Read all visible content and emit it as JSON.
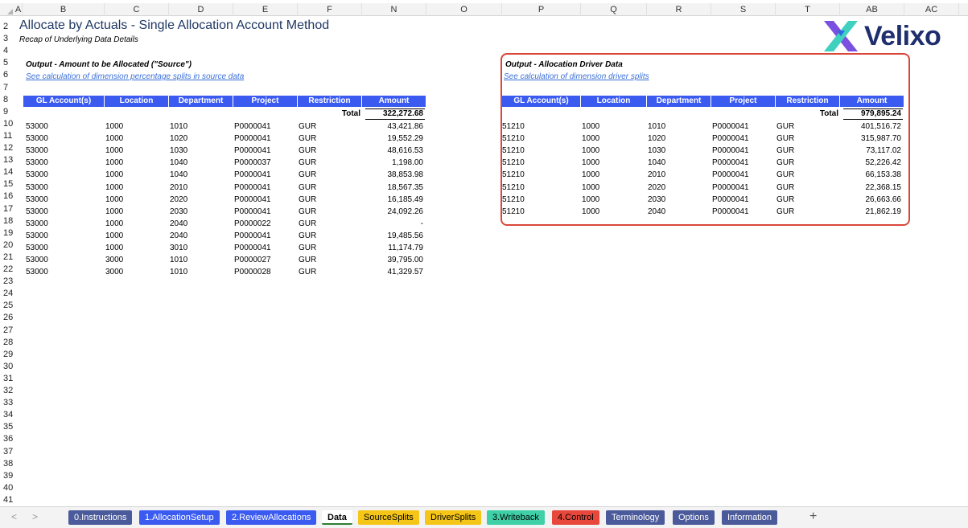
{
  "columns": [
    "A",
    "B",
    "C",
    "D",
    "E",
    "F",
    "N",
    "O",
    "P",
    "Q",
    "R",
    "S",
    "T",
    "AB",
    "AC"
  ],
  "rows": [
    "2",
    "3",
    "4",
    "5",
    "6",
    "7",
    "8",
    "9",
    "10",
    "11",
    "12",
    "13",
    "14",
    "15",
    "16",
    "17",
    "18",
    "19",
    "20",
    "21",
    "22",
    "23",
    "24",
    "25",
    "26",
    "27",
    "28",
    "29",
    "30",
    "31",
    "32",
    "33",
    "34",
    "35",
    "36",
    "37",
    "38",
    "39",
    "40",
    "41"
  ],
  "title": "Allocate by Actuals - Single Allocation Account Method",
  "subtitle": "Recap of Underlying Data Details",
  "logo_text": "Velixo",
  "source": {
    "heading": "Output - Amount to be Allocated (\"Source\")",
    "link": "See calculation of dimension percentage splits in source data",
    "headers": [
      "GL Account(s)",
      "Location",
      "Department",
      "Project",
      "Restriction",
      "Amount"
    ],
    "total_label": "Total",
    "total_value": "322,272.68",
    "rows": [
      [
        "53000",
        "1000",
        "1010",
        "P0000041",
        "GUR",
        "43,421.86"
      ],
      [
        "53000",
        "1000",
        "1020",
        "P0000041",
        "GUR",
        "19,552.29"
      ],
      [
        "53000",
        "1000",
        "1030",
        "P0000041",
        "GUR",
        "48,616.53"
      ],
      [
        "53000",
        "1000",
        "1040",
        "P0000037",
        "GUR",
        "1,198.00"
      ],
      [
        "53000",
        "1000",
        "1040",
        "P0000041",
        "GUR",
        "38,853.98"
      ],
      [
        "53000",
        "1000",
        "2010",
        "P0000041",
        "GUR",
        "18,567.35"
      ],
      [
        "53000",
        "1000",
        "2020",
        "P0000041",
        "GUR",
        "16,185.49"
      ],
      [
        "53000",
        "1000",
        "2030",
        "P0000041",
        "GUR",
        "24,092.26"
      ],
      [
        "53000",
        "1000",
        "2040",
        "P0000022",
        "GUR",
        "-"
      ],
      [
        "53000",
        "1000",
        "2040",
        "P0000041",
        "GUR",
        "19,485.56"
      ],
      [
        "53000",
        "1000",
        "3010",
        "P0000041",
        "GUR",
        "11,174.79"
      ],
      [
        "53000",
        "3000",
        "1010",
        "P0000027",
        "GUR",
        "39,795.00"
      ],
      [
        "53000",
        "3000",
        "1010",
        "P0000028",
        "GUR",
        "41,329.57"
      ]
    ]
  },
  "driver": {
    "heading": "Output - Allocation Driver Data",
    "link": "See calculation of dimension driver splits",
    "headers": [
      "GL Account(s)",
      "Location",
      "Department",
      "Project",
      "Restriction",
      "Amount"
    ],
    "total_label": "Total",
    "total_value": "979,895.24",
    "rows": [
      [
        "51210",
        "1000",
        "1010",
        "P0000041",
        "GUR",
        "401,516.72"
      ],
      [
        "51210",
        "1000",
        "1020",
        "P0000041",
        "GUR",
        "315,987.70"
      ],
      [
        "51210",
        "1000",
        "1030",
        "P0000041",
        "GUR",
        "73,117.02"
      ],
      [
        "51210",
        "1000",
        "1040",
        "P0000041",
        "GUR",
        "52,226.42"
      ],
      [
        "51210",
        "1000",
        "2010",
        "P0000041",
        "GUR",
        "66,153.38"
      ],
      [
        "51210",
        "1000",
        "2020",
        "P0000041",
        "GUR",
        "22,368.15"
      ],
      [
        "51210",
        "1000",
        "2030",
        "P0000041",
        "GUR",
        "26,663.66"
      ],
      [
        "51210",
        "1000",
        "2040",
        "P0000041",
        "GUR",
        "21,862.19"
      ]
    ]
  },
  "tabs": [
    {
      "label": "0.Instructions",
      "bg": "#4a5a9a",
      "fg": "#ffffff"
    },
    {
      "label": "1.AllocationSetup",
      "bg": "#3b5bf0",
      "fg": "#ffffff"
    },
    {
      "label": "2.ReviewAllocations",
      "bg": "#3b5bf0",
      "fg": "#ffffff"
    },
    {
      "label": "Data",
      "bg": "#ffffff",
      "fg": "#000000",
      "active": true
    },
    {
      "label": "SourceSplits",
      "bg": "#f5c518",
      "fg": "#000000"
    },
    {
      "label": "DriverSplits",
      "bg": "#f5c518",
      "fg": "#000000"
    },
    {
      "label": "3.Writeback",
      "bg": "#3fd0a8",
      "fg": "#000000"
    },
    {
      "label": "4.Control",
      "bg": "#e8473b",
      "fg": "#000000"
    },
    {
      "label": "Terminology",
      "bg": "#4a5a9a",
      "fg": "#ffffff"
    },
    {
      "label": "Options",
      "bg": "#4a5a9a",
      "fg": "#ffffff"
    },
    {
      "label": "Information",
      "bg": "#4a5a9a",
      "fg": "#ffffff"
    }
  ],
  "nav": {
    "prev": "<",
    "next": ">",
    "add": "+"
  }
}
